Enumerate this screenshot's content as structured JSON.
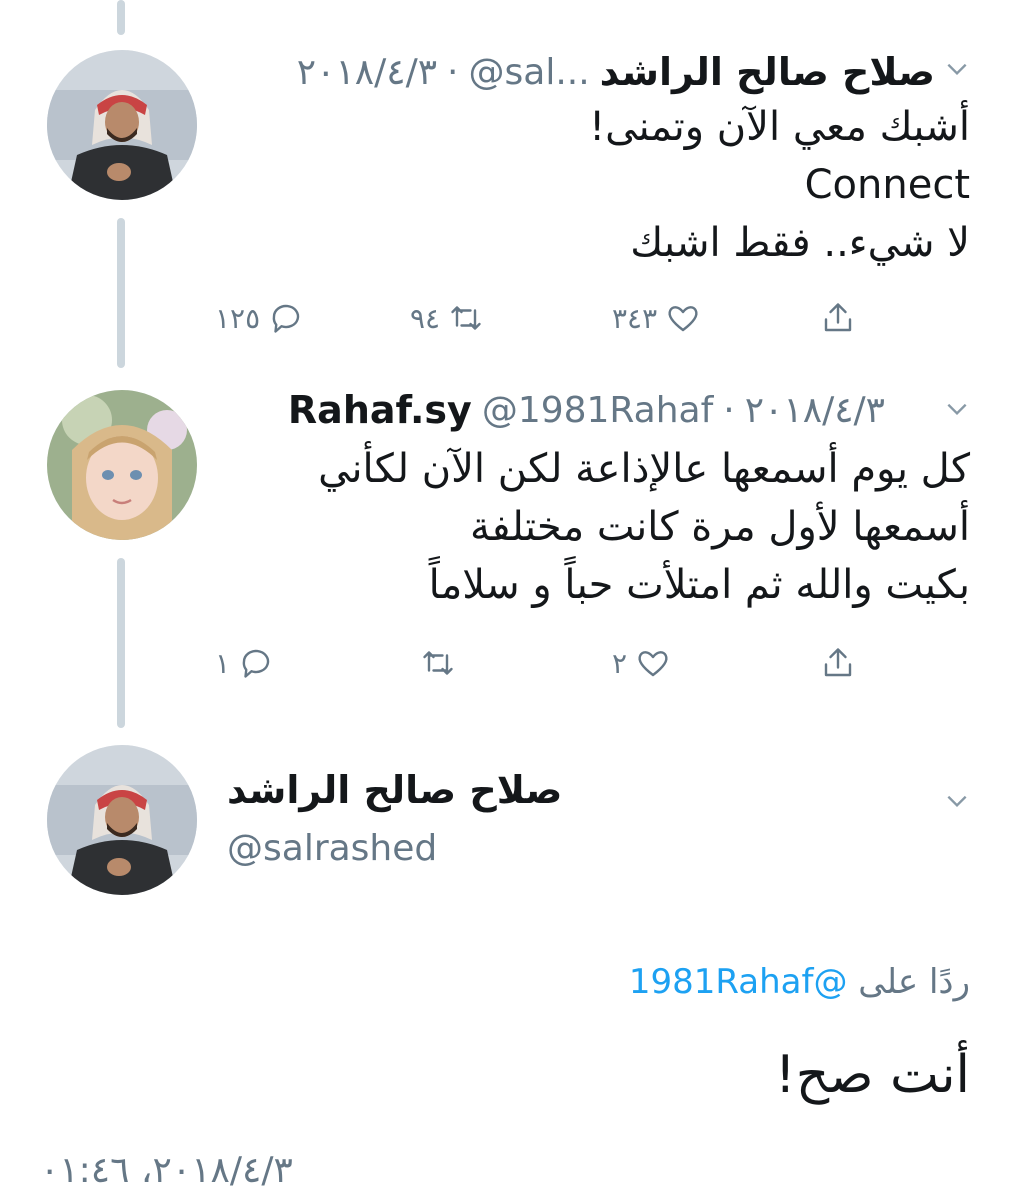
{
  "tweets": [
    {
      "name": "صلاح صالح الراشد",
      "handle": "@sal...",
      "date": "٢٠١٨/٤/٣",
      "lines": [
        "أشبك معي الآن وتمنى!",
        "Connect",
        "لا شيء.. فقط اشبك"
      ],
      "replies": "١٢٥",
      "retweets": "٩٤",
      "likes": "٣٤٣"
    },
    {
      "name": "Rahaf.sy",
      "handle": "@1981Rahaf",
      "date": "٢٠١٨/٤/٣",
      "lines": [
        "كل يوم أسمعها عالإذاعة لكن الآن لكأني",
        "أسمعها لأول مرة كانت مختلفة",
        "بكيت والله ثم امتلأت حباً و سلاماً"
      ],
      "replies": "١",
      "retweets": "",
      "likes": "٢"
    }
  ],
  "focused": {
    "name": "صلاح صالح الراشد",
    "handle": "@salrashed",
    "reply_label": "ردًا على",
    "reply_mention": "@1981Rahaf",
    "text": "أنت صح!",
    "timestamp": "٢٠١٨/٤/٣، ٠١:٤٦"
  },
  "icons": {
    "reply": "reply-icon",
    "retweet": "retweet-icon",
    "like": "heart-icon",
    "share": "share-icon",
    "menu": "chevron-down-icon"
  }
}
